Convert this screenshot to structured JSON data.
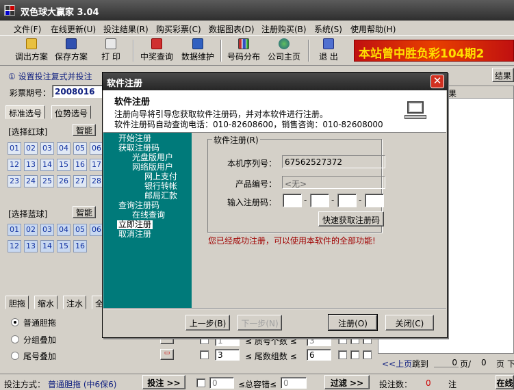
{
  "window": {
    "title": "双色球大赢家 3.04"
  },
  "menu": [
    "文件(F)",
    "在线更新(U)",
    "投注结果(R)",
    "购买彩票(C)",
    "数据图表(D)",
    "注册购买(B)",
    "系统(S)",
    "使用帮助(H)"
  ],
  "toolbar": {
    "buttons": [
      {
        "label": "调出方案",
        "icon": "folder-open-icon"
      },
      {
        "label": "保存方案",
        "icon": "save-icon"
      },
      {
        "label": "打 印",
        "icon": "printer-icon"
      },
      {
        "label": "中奖查询",
        "icon": "award-icon"
      },
      {
        "label": "数据维护",
        "icon": "database-icon"
      },
      {
        "label": "号码分布",
        "icon": "bar-chart-icon"
      },
      {
        "label": "公司主页",
        "icon": "globe-icon"
      },
      {
        "label": "退 出",
        "icon": "exit-icon"
      }
    ]
  },
  "banner": "本站曾中胜负彩104期2",
  "main": {
    "hint": "① 设置投注复式并投注",
    "issue_label": "彩票期号：",
    "issue_value": "2008016",
    "tabs": [
      "标准选号",
      "位势选号"
    ],
    "red_label": "[选择红球]",
    "blue_label": "[选择蓝球]",
    "smart": "智能",
    "red_balls": [
      "01",
      "02",
      "03",
      "04",
      "05",
      "06",
      "12",
      "13",
      "14",
      "15",
      "16",
      "17",
      "23",
      "24",
      "25",
      "26",
      "27",
      "28"
    ],
    "blue_balls": [
      "01",
      "02",
      "03",
      "04",
      "05",
      "06",
      "12",
      "13",
      "14",
      "15",
      "16"
    ],
    "bottom_tabs": [
      "胆拖",
      "缩水",
      "注水",
      "全"
    ],
    "options": [
      "普通胆拖",
      "分组叠加",
      "尾号叠加"
    ],
    "method_label": "投注方式：",
    "method_value": "普通胆拖 (中6保6)",
    "bet_button": "投注 >>",
    "filter_rows": [
      {
        "min": "1",
        "mid": "≤ 质号个数 ≤",
        "max": "3"
      },
      {
        "min": "3",
        "mid": "≤ 尾数组数 ≤",
        "max": "6"
      },
      {
        "min": "0",
        "mid": "≤总容错≤",
        "max": "0"
      }
    ],
    "filter_button": "过滤 >>"
  },
  "right": {
    "result_button": "结果",
    "result_header": "果",
    "pager": {
      "prev": "<<上页",
      "goto": "跳到",
      "page": "0",
      "page_suffix": "页/",
      "total": "0",
      "suffix": "页",
      "next": "下"
    },
    "count_label": "投注数：",
    "count_value": "0",
    "note_suffix": "注",
    "online_button": "在线"
  },
  "dialog": {
    "title": "软件注册",
    "heading": "软件注册",
    "desc1": "注册向导将引导您获取软件注册码，并对本软件进行注册。",
    "desc2": "软件注册码自动查询电话：010-82608600，销售咨询：010-82608000",
    "nav": [
      "开始注册",
      "获取注册码",
      "光盘版用户",
      "网络版用户",
      "网上支付",
      "银行转帐",
      "邮局汇款",
      "查询注册码",
      "在线查询",
      "立即注册",
      "取消注册"
    ],
    "group_title": "软件注册(R)",
    "serial_label": "本机序列号：",
    "serial_value": "67562527372",
    "product_label": "产品编号：",
    "product_value": "<无>",
    "code_label": "输入注册码：",
    "quick_button": "快速获取注册码",
    "success_msg": "您已经成功注册，可以使用本软件的全部功能!",
    "prev_button": "上一步(B)",
    "next_button": "下一步(N)",
    "register_button": "注册(O)",
    "close_button": "关闭(C)"
  }
}
